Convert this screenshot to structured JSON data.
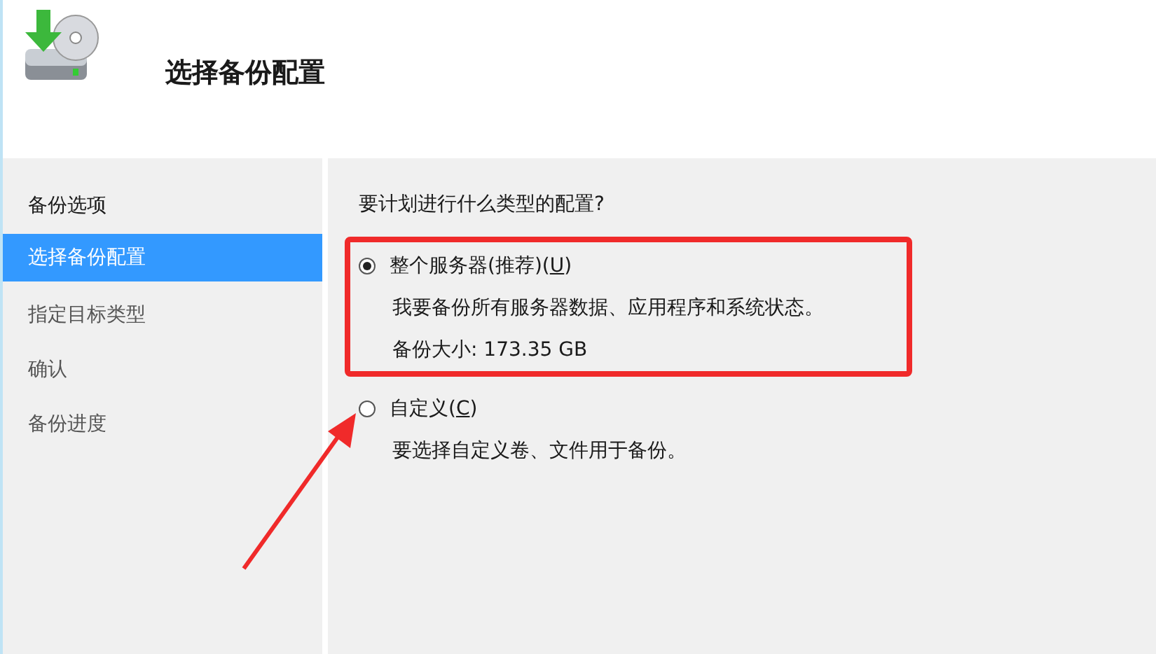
{
  "header": {
    "title": "选择备份配置"
  },
  "sidebar": {
    "items": [
      {
        "label": "备份选项",
        "kind": "heading",
        "selected": false
      },
      {
        "label": "选择备份配置",
        "kind": "step",
        "selected": true
      },
      {
        "label": "指定目标类型",
        "kind": "step",
        "selected": false
      },
      {
        "label": "确认",
        "kind": "step",
        "selected": false
      },
      {
        "label": "备份进度",
        "kind": "step",
        "selected": false
      }
    ]
  },
  "content": {
    "question": "要计划进行什么类型的配置?",
    "options": [
      {
        "label_before": "整个服务器(推荐)(",
        "access_key": "U",
        "label_after": ")",
        "selected": true,
        "highlighted": true,
        "details": [
          "我要备份所有服务器数据、应用程序和系统状态。",
          "备份大小: 173.35 GB"
        ]
      },
      {
        "label_before": "自定义(",
        "access_key": "C",
        "label_after": ")",
        "selected": false,
        "highlighted": false,
        "details": [
          "要选择自定义卷、文件用于备份。"
        ]
      }
    ]
  }
}
